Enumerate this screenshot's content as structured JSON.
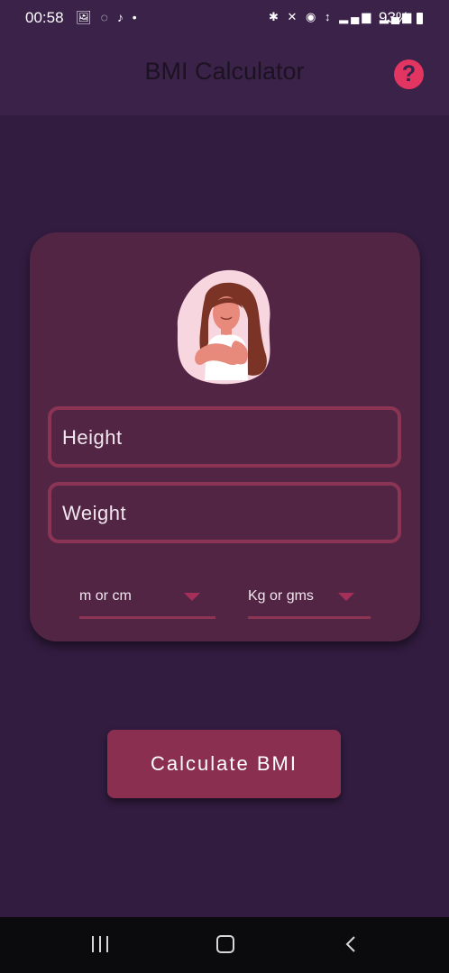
{
  "status_bar": {
    "time": "00:58",
    "battery": "93%",
    "left_icons": [
      "gallery-icon",
      "chat-icon",
      "tiktok-icon",
      "dot-icon"
    ],
    "right_icons": [
      "bluetooth-icon",
      "mute-icon",
      "hotspot-icon",
      "4g-icon",
      "signal-icon",
      "signal-icon",
      "battery-icon"
    ]
  },
  "app_bar": {
    "title": "BMI Calculator",
    "help_label": "?",
    "help_color": "#e23561"
  },
  "form": {
    "height_placeholder": "Height",
    "weight_placeholder": "Weight",
    "height_unit": "m or cm",
    "weight_unit": "Kg or gms"
  },
  "actions": {
    "calculate_label": "Calculate BMI"
  },
  "colors": {
    "background": "#321c40",
    "card": "#522544",
    "accent": "#8b3454",
    "button": "#8a2f4f"
  },
  "nav_bar": {
    "icons": [
      "recent-apps-icon",
      "home-icon",
      "back-icon"
    ]
  }
}
